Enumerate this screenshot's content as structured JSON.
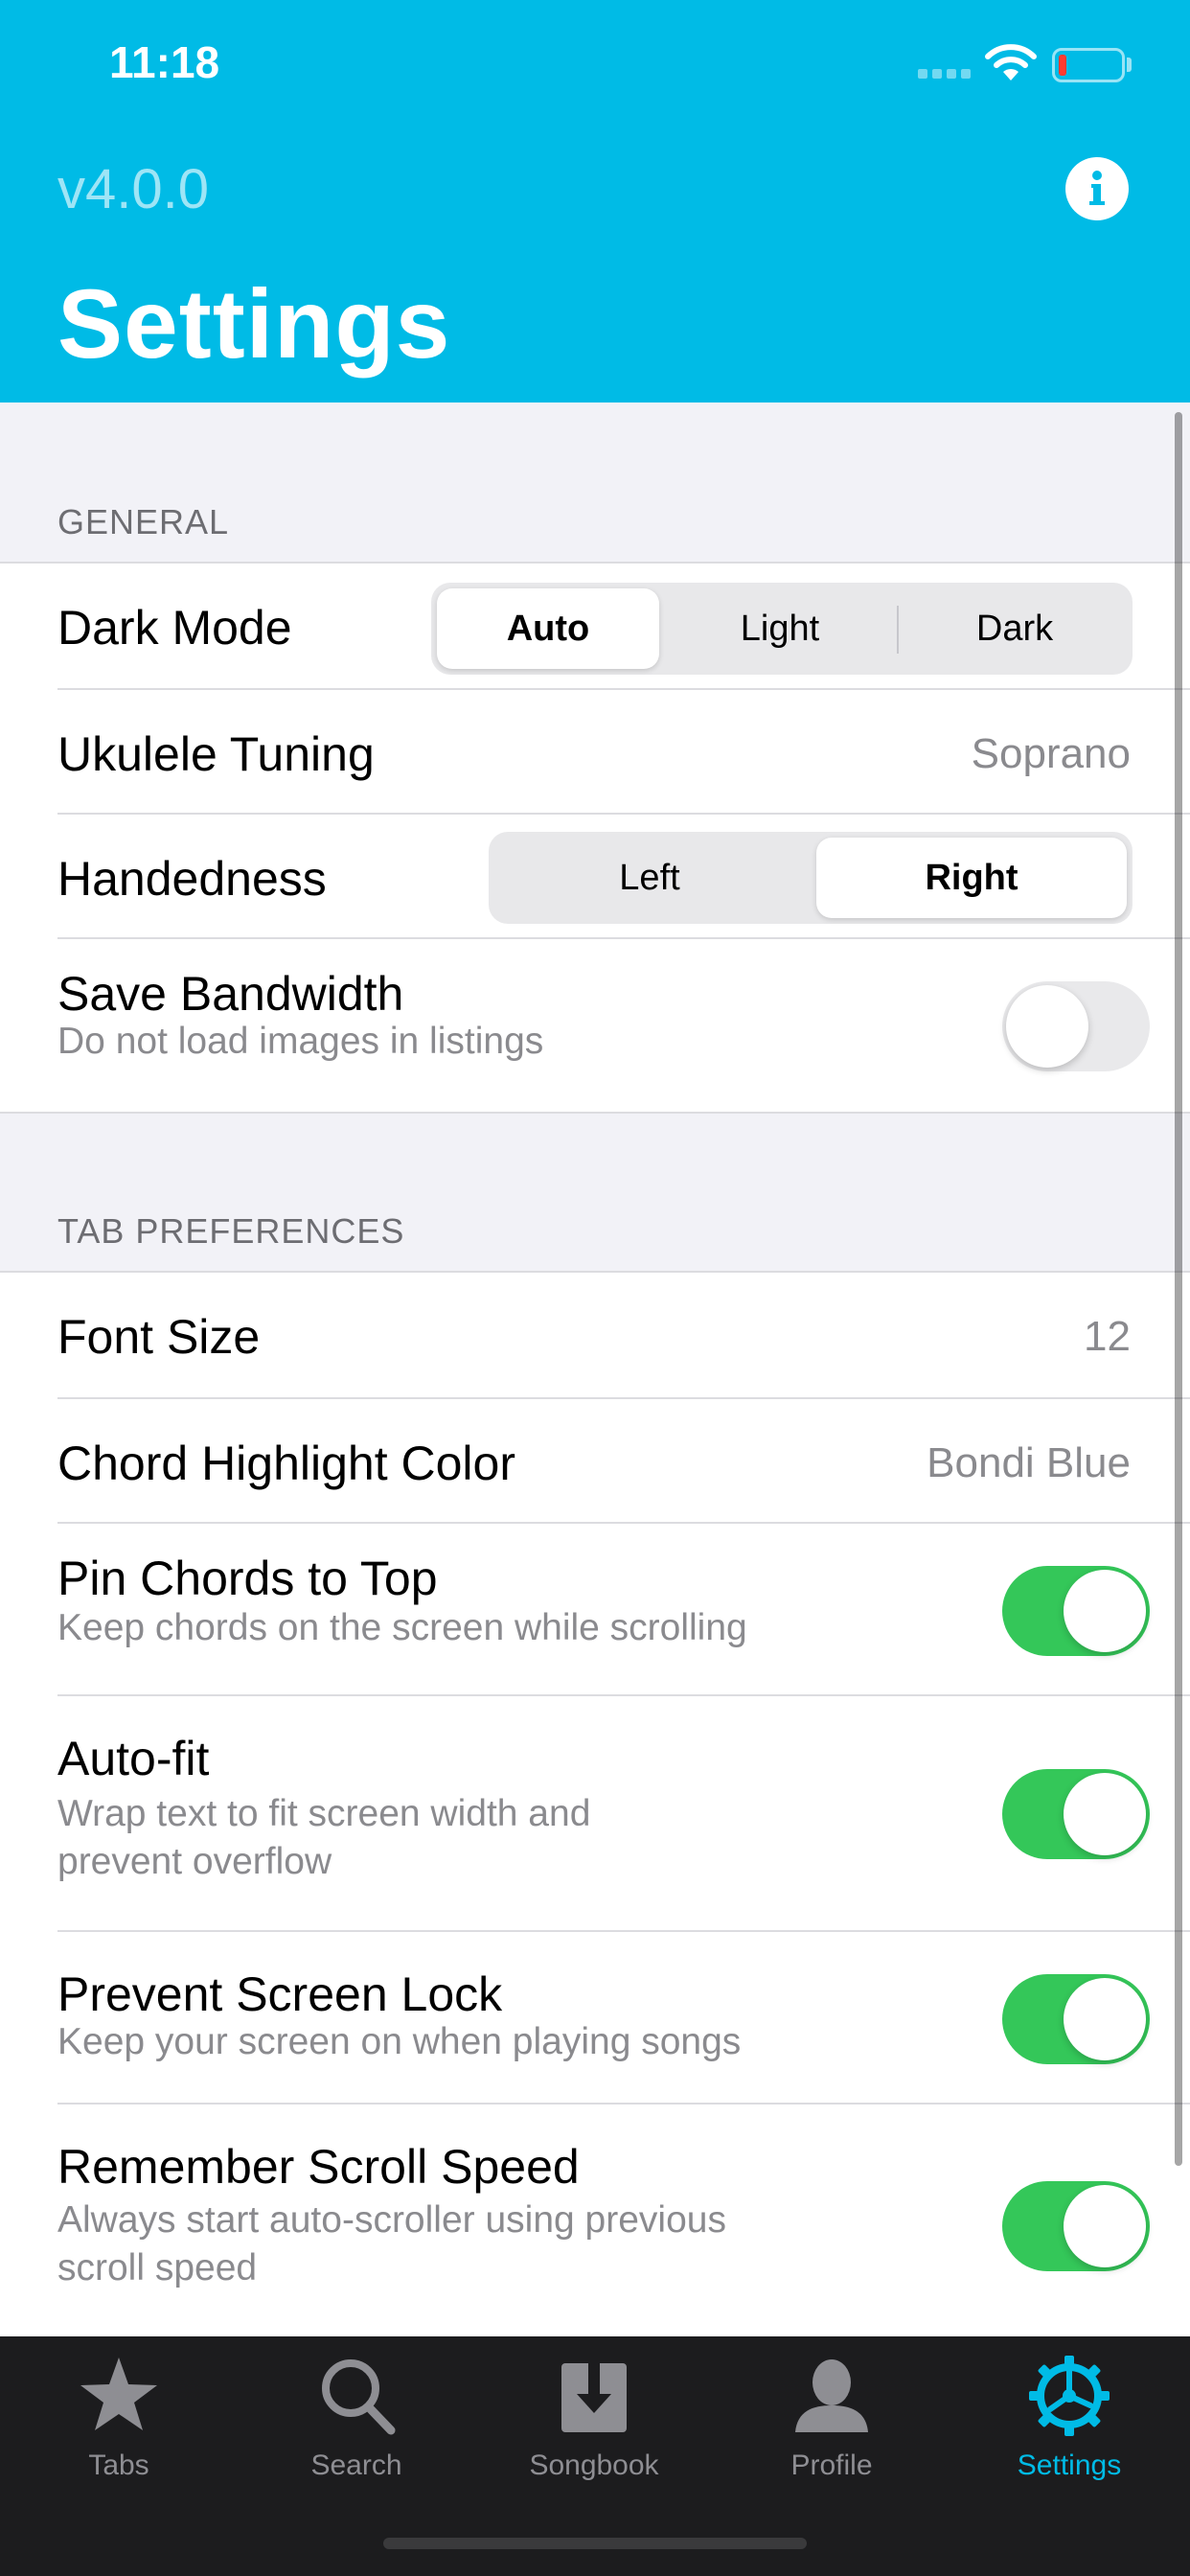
{
  "status_bar": {
    "time": "11:18"
  },
  "header": {
    "version": "v4.0.0",
    "title": "Settings",
    "info_icon": "info-icon"
  },
  "general": {
    "header": "GENERAL",
    "dark_mode": {
      "label": "Dark Mode",
      "options": [
        "Auto",
        "Light",
        "Dark"
      ],
      "selected": "Auto"
    },
    "ukulele_tuning": {
      "label": "Ukulele Tuning",
      "value": "Soprano"
    },
    "handedness": {
      "label": "Handedness",
      "options": [
        "Left",
        "Right"
      ],
      "selected": "Right"
    },
    "save_bandwidth": {
      "label": "Save Bandwidth",
      "subtitle": "Do not load images in listings",
      "enabled": false
    }
  },
  "tab_preferences": {
    "header": "TAB PREFERENCES",
    "font_size": {
      "label": "Font Size",
      "value": "12"
    },
    "chord_highlight": {
      "label": "Chord Highlight Color",
      "value": "Bondi Blue"
    },
    "pin_chords": {
      "label": "Pin Chords to Top",
      "subtitle": "Keep chords on the screen while scrolling",
      "enabled": true
    },
    "auto_fit": {
      "label": "Auto-fit",
      "subtitle_line1": "Wrap text to fit screen width and",
      "subtitle_line2": "prevent overflow",
      "enabled": true
    },
    "prevent_lock": {
      "label": "Prevent Screen Lock",
      "subtitle": "Keep your screen on when playing songs",
      "enabled": true
    },
    "remember_scroll": {
      "label": "Remember Scroll Speed",
      "subtitle_line1": "Always start auto-scroller using previous",
      "subtitle_line2": "scroll speed",
      "enabled": true
    }
  },
  "tab_bar": {
    "items": [
      {
        "label": "Tabs",
        "icon": "star-icon"
      },
      {
        "label": "Search",
        "icon": "magnifier-icon"
      },
      {
        "label": "Songbook",
        "icon": "download-box-icon"
      },
      {
        "label": "Profile",
        "icon": "person-icon"
      },
      {
        "label": "Settings",
        "icon": "gear-icon"
      }
    ],
    "active": "Settings"
  },
  "colors": {
    "accent": "#00bbe6",
    "toggle_on": "#34c759",
    "tabbar_bg": "#1c1c1e"
  }
}
